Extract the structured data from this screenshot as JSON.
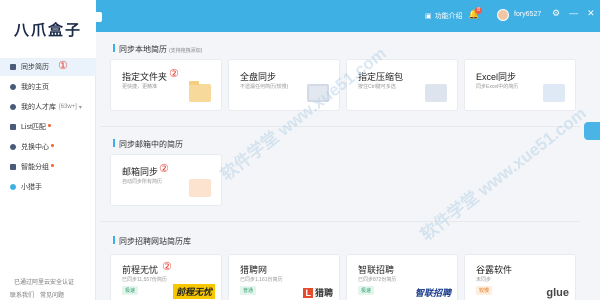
{
  "app": {
    "logo": "八爪盒子"
  },
  "topbar": {
    "feature_intro": "功能介绍",
    "notif_count": "8",
    "username": "fory6527",
    "controls": [
      "⚙",
      "—",
      "✕"
    ]
  },
  "sidebar": {
    "items": [
      {
        "label": "同步简历",
        "marker": "①"
      },
      {
        "label": "我的主页"
      },
      {
        "label": "我的人才库",
        "count": "[63w+]"
      },
      {
        "label": "List匹配"
      },
      {
        "label": "兑换中心"
      },
      {
        "label": "智能分组"
      },
      {
        "label": "小猎手"
      }
    ],
    "footer_status": "已通过阿里云安全认证",
    "footer_links": [
      "联系我们",
      "常见问题"
    ]
  },
  "sections": {
    "local": {
      "title": "同步本地简历",
      "sub": "(支持拖拽添加)"
    },
    "email": {
      "title": "同步邮箱中的简历"
    },
    "job_sites": {
      "title": "同步招聘网站简历库"
    }
  },
  "local_cards": [
    {
      "title": "指定文件夹",
      "desc": "更快捷，更精准",
      "marker": "②",
      "icon": "folder-icon"
    },
    {
      "title": "全盘同步",
      "desc": "不遗漏任何简历(较慢)",
      "icon": "monitor-icon"
    },
    {
      "title": "指定压缩包",
      "desc": "按住Ctrl键可多选",
      "icon": "zip-icon"
    },
    {
      "title": "Excel同步",
      "desc": "同步Excel中的简历",
      "icon": "excel-icon"
    }
  ],
  "email_cards": [
    {
      "title": "邮箱同步",
      "desc": "自动同步所有简历",
      "marker": "②",
      "icon": "mail-icon"
    }
  ],
  "job_cards": [
    {
      "title": "前程无忧",
      "desc": "已同步11,557份简历",
      "tag": "极速",
      "marker": "②",
      "brand": "前程无忧"
    },
    {
      "title": "猎聘网",
      "desc": "已同步1,161份简历",
      "tag": "普通",
      "brand_l": "L",
      "brand": "猎聘"
    },
    {
      "title": "智联招聘",
      "desc": "已同步872份简历",
      "tag": "极速",
      "brand": "智联招聘"
    },
    {
      "title": "谷露软件",
      "desc": "未同步",
      "tag": "较慢",
      "brand": "glue"
    }
  ],
  "watermark": "软件学堂 www.xue51.com"
}
